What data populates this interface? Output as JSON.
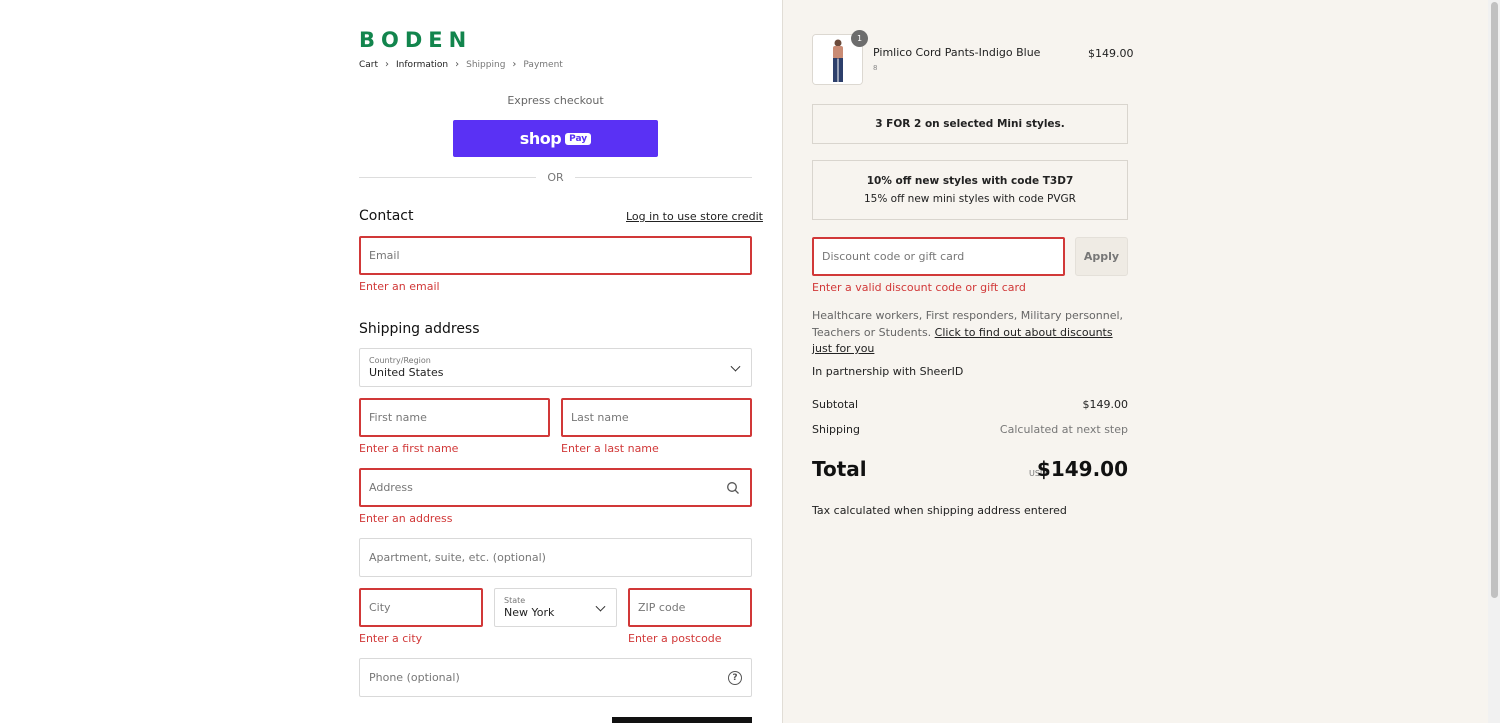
{
  "brand": {
    "logo_text": "BODEN",
    "logo_color": "#12854d"
  },
  "breadcrumb": {
    "items": [
      "Cart",
      "Information",
      "Shipping",
      "Payment"
    ],
    "active": "Information"
  },
  "express": {
    "label": "Express checkout",
    "shoppay_text": "shop",
    "shoppay_badge": "Pay",
    "shoppay_color": "#5a31f4",
    "or": "OR"
  },
  "contact": {
    "title": "Contact",
    "login_link": "Log in to use store credit",
    "email_placeholder": "Email",
    "email_error": "Enter an email"
  },
  "shipping": {
    "title": "Shipping address",
    "country_label": "Country/Region",
    "country_value": "United States",
    "first_name_placeholder": "First name",
    "first_name_error": "Enter a first name",
    "last_name_placeholder": "Last name",
    "last_name_error": "Enter a last name",
    "address_placeholder": "Address",
    "address_error": "Enter an address",
    "apartment_placeholder": "Apartment, suite, etc. (optional)",
    "city_placeholder": "City",
    "city_error": "Enter a city",
    "state_label": "State",
    "state_value": "New York",
    "zip_placeholder": "ZIP code",
    "zip_error": "Enter a postcode",
    "phone_placeholder": "Phone (optional)",
    "error_color": "#d13838"
  },
  "order": {
    "product": {
      "name": "Pimlico Cord Pants-Indigo Blue",
      "variant": "8",
      "price": "$149.00",
      "quantity": "1"
    },
    "promo1": "3 FOR 2 on selected Mini styles.",
    "promo2_bold": "10% off new styles with code T3D7",
    "promo2_text": "15% off new mini styles with code PVGR",
    "discount_placeholder": "Discount code or gift card",
    "apply_label": "Apply",
    "discount_error": "Enter a valid discount code or gift card",
    "sheer_text": "Healthcare workers, First responders, Military personnel, Teachers or Students. ",
    "sheer_link": "Click to find out about discounts just for you",
    "partner": "In partnership with SheerID",
    "subtotal_label": "Subtotal",
    "subtotal_value": "$149.00",
    "shipping_label": "Shipping",
    "shipping_value": "Calculated at next step",
    "total_label": "Total",
    "total_currency": "USD",
    "total_value": "$149.00",
    "tax_note": "Tax calculated when shipping address entered",
    "background": "#f7f4ef"
  }
}
